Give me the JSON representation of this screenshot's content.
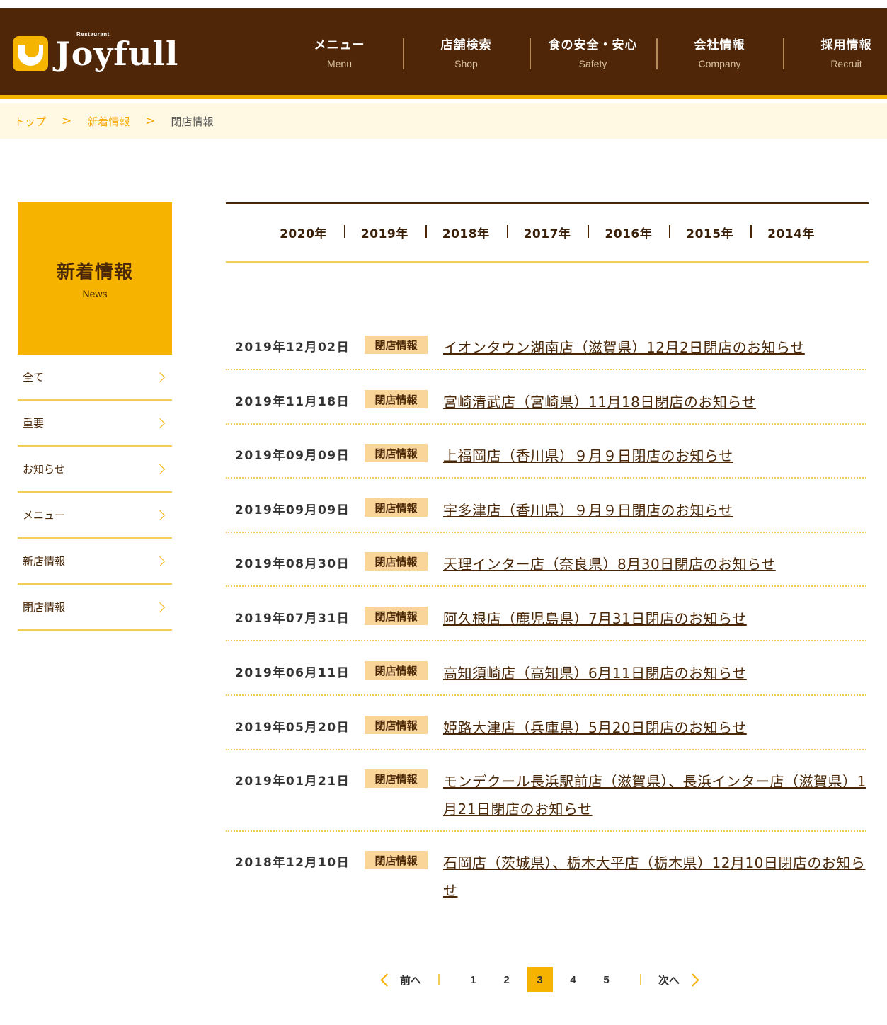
{
  "header": {
    "logo_small": "Restaurant",
    "logo_text": "Joyfull",
    "nav": [
      {
        "jp": "メニュー",
        "en": "Menu"
      },
      {
        "jp": "店舗検索",
        "en": "Shop"
      },
      {
        "jp": "食の安全・安心",
        "en": "Safety"
      },
      {
        "jp": "会社情報",
        "en": "Company"
      },
      {
        "jp": "採用情報",
        "en": "Recruit"
      }
    ]
  },
  "breadcrumb": {
    "items": [
      "トップ",
      "新着情報"
    ],
    "separator": ">",
    "current": "閉店情報"
  },
  "sidebar": {
    "title": "新着情報",
    "subtitle": "News",
    "items": [
      "全て",
      "重要",
      "お知らせ",
      "メニュー",
      "新店情報",
      "閉店情報"
    ]
  },
  "years": [
    "2020年",
    "2019年",
    "2018年",
    "2017年",
    "2016年",
    "2015年",
    "2014年"
  ],
  "news": [
    {
      "date": "2019年12月02日",
      "badge": "閉店情報",
      "title": "イオンタウン湖南店（滋賀県）12月2日閉店のお知らせ"
    },
    {
      "date": "2019年11月18日",
      "badge": "閉店情報",
      "title": "宮崎清武店（宮崎県）11月18日閉店のお知らせ"
    },
    {
      "date": "2019年09月09日",
      "badge": "閉店情報",
      "title": "上福岡店（香川県）９月９日閉店のお知らせ"
    },
    {
      "date": "2019年09月09日",
      "badge": "閉店情報",
      "title": "宇多津店（香川県）９月９日閉店のお知らせ"
    },
    {
      "date": "2019年08月30日",
      "badge": "閉店情報",
      "title": "天理インター店（奈良県）8月30日閉店のお知らせ"
    },
    {
      "date": "2019年07月31日",
      "badge": "閉店情報",
      "title": "阿久根店（鹿児島県）7月31日閉店のお知らせ"
    },
    {
      "date": "2019年06月11日",
      "badge": "閉店情報",
      "title": "高知須崎店（高知県）6月11日閉店のお知らせ"
    },
    {
      "date": "2019年05月20日",
      "badge": "閉店情報",
      "title": "姫路大津店（兵庫県）5月20日閉店のお知らせ"
    },
    {
      "date": "2019年01月21日",
      "badge": "閉店情報",
      "title": "モンデクール長浜駅前店（滋賀県）、長浜インター店（滋賀県）1月21日閉店のお知らせ"
    },
    {
      "date": "2018年12月10日",
      "badge": "閉店情報",
      "title": "石岡店（茨城県）、栃木大平店（栃木県）12月10日閉店のお知らせ"
    }
  ],
  "pagination": {
    "prev": "前へ",
    "next": "次へ",
    "pages": [
      "1",
      "2",
      "3",
      "4",
      "5"
    ],
    "current": "3"
  },
  "colors": {
    "header_bg": "#4f2708",
    "accent": "#f6b300",
    "badge_bg": "#fad59a",
    "breadcrumb_bg": "#fff9e4"
  }
}
